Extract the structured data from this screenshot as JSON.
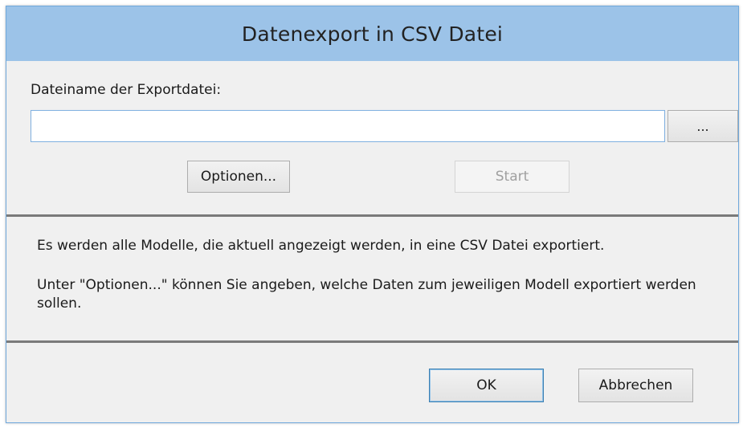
{
  "window": {
    "title": "Datenexport in CSV Datei"
  },
  "export": {
    "filename_label": "Dateiname der Exportdatei:",
    "filename_value": "",
    "browse_label": "...",
    "options_label": "Optionen...",
    "start_label": "Start"
  },
  "info": {
    "line1": "Es werden alle Modelle, die aktuell angezeigt werden, in eine CSV Datei exportiert.",
    "line2": "Unter \"Optionen...\" können Sie angeben, welche Daten zum jeweiligen Modell exportiert werden sollen."
  },
  "footer": {
    "ok_label": "OK",
    "cancel_label": "Abbrechen"
  },
  "colors": {
    "titlebar": "#9cc3e8",
    "background": "#f0f0f0",
    "focus_border": "#3c7fb1"
  }
}
